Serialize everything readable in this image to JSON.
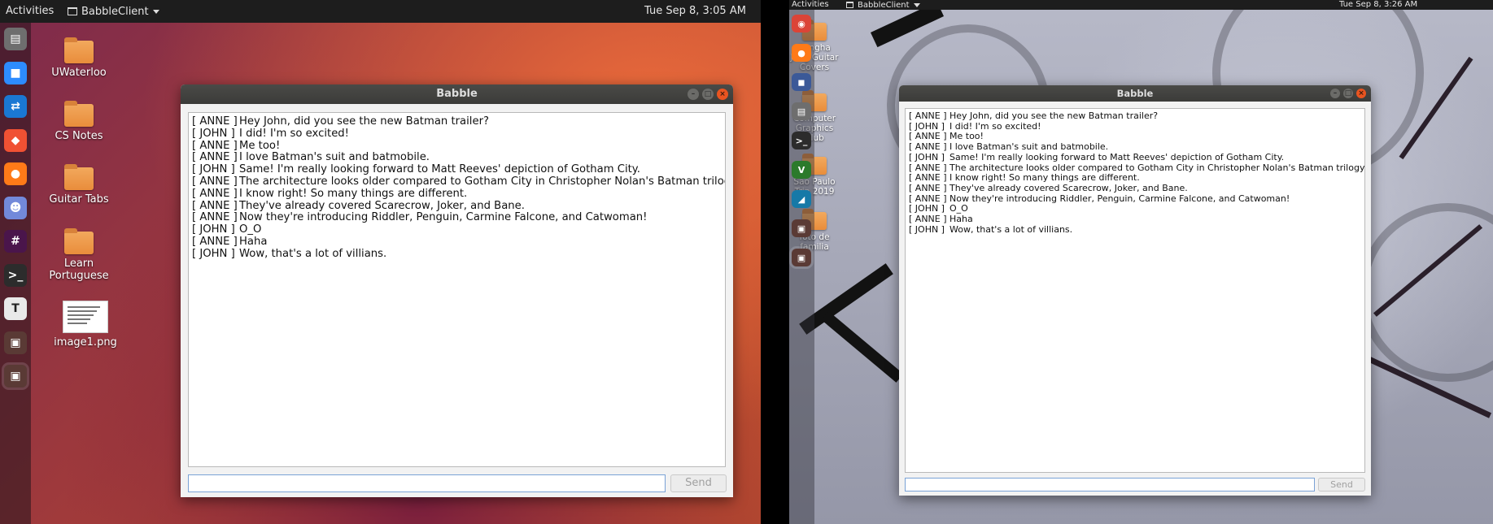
{
  "left": {
    "topbar": {
      "activities": "Activities",
      "app": "BabbleClient",
      "clock": "Tue Sep  8,  3:05 AM"
    },
    "dock": [
      {
        "icon": "files-icon",
        "glyph": "▤",
        "color": "#6e6e6e"
      },
      {
        "icon": "zoom-icon",
        "glyph": "■",
        "color": "#2d8cff"
      },
      {
        "icon": "teamviewer-icon",
        "glyph": "⇄",
        "color": "#1a78d3"
      },
      {
        "icon": "git-icon",
        "glyph": "◆",
        "color": "#f05133"
      },
      {
        "icon": "firefox-icon",
        "glyph": "●",
        "color": "#ff7a18"
      },
      {
        "icon": "discord-icon",
        "glyph": "☻",
        "color": "#7289da"
      },
      {
        "icon": "slack-icon",
        "glyph": "#",
        "color": "#4a154b"
      },
      {
        "icon": "terminal-icon",
        "glyph": ">_",
        "color": "#2c2c2c"
      },
      {
        "icon": "typora-icon",
        "glyph": "T",
        "color": "#e9e9e9"
      },
      {
        "icon": "app-window-icon",
        "glyph": "▣",
        "color": "#5a3a35"
      },
      {
        "icon": "app-window-icon",
        "glyph": "▣",
        "color": "#5a3a35"
      }
    ],
    "desktop": [
      {
        "label": "UWaterloo",
        "kind": "folder"
      },
      {
        "label": "CS Notes",
        "kind": "folder"
      },
      {
        "label": "Guitar Tabs",
        "kind": "folder"
      },
      {
        "label": "Learn Portuguese",
        "kind": "folder"
      },
      {
        "label": "image1.png",
        "kind": "image"
      }
    ],
    "window": {
      "title": "Babble",
      "messages": [
        {
          "sender": "[ ANNE ]",
          "text": "Hey John, did you see the new Batman trailer?"
        },
        {
          "sender": "[ JOHN ]",
          "text": "I did! I'm so excited!"
        },
        {
          "sender": "[ ANNE ]",
          "text": "Me too!"
        },
        {
          "sender": "[ ANNE ]",
          "text": "I love Batman's suit and batmobile."
        },
        {
          "sender": "[ JOHN ]",
          "text": "Same! I'm really looking forward to Matt Reeves' depiction of Gotham City."
        },
        {
          "sender": "[ ANNE ]",
          "text": "The architecture looks older compared to Gotham City in Christopher Nolan's Batman trilogy."
        },
        {
          "sender": "[ ANNE ]",
          "text": "I know right! So many things are different."
        },
        {
          "sender": "[ ANNE ]",
          "text": "They've already covered Scarecrow, Joker, and Bane."
        },
        {
          "sender": "[ ANNE ]",
          "text": "Now they're introducing Riddler, Penguin, Carmine Falcone, and Catwoman!"
        },
        {
          "sender": "[ JOHN ]",
          "text": "O_O"
        },
        {
          "sender": "[ ANNE ]",
          "text": "Haha"
        },
        {
          "sender": "[ JOHN ]",
          "text": "Wow, that's a lot of villians."
        }
      ],
      "input_value": "",
      "send_label": "Send"
    }
  },
  "right": {
    "topbar": {
      "activities": "Activities",
      "app": "BabbleClient",
      "clock": "Tue Sep  8,  3:26 AM"
    },
    "dock": [
      {
        "icon": "chrome-icon",
        "glyph": "◉",
        "color": "#db4437"
      },
      {
        "icon": "firefox-icon",
        "glyph": "●",
        "color": "#ff7a18"
      },
      {
        "icon": "messenger-icon",
        "glyph": "◼",
        "color": "#3b5998"
      },
      {
        "icon": "files-icon",
        "glyph": "▤",
        "color": "#6e6e6e"
      },
      {
        "icon": "terminal-icon",
        "glyph": ">_",
        "color": "#2c2c2c"
      },
      {
        "icon": "vim-icon",
        "glyph": "V",
        "color": "#2b7a2b"
      },
      {
        "icon": "wireshark-icon",
        "glyph": "◢",
        "color": "#1679a7"
      },
      {
        "icon": "app-window-icon",
        "glyph": "▣",
        "color": "#5a3a35"
      },
      {
        "icon": "app-window-icon",
        "glyph": "▣",
        "color": "#5a3a35"
      }
    ],
    "desktop": [
      {
        "label": "Sungha Jung Guitar Covers",
        "kind": "folder"
      },
      {
        "label": "Computer Graphics Club",
        "kind": "folder"
      },
      {
        "label": "São Paulo Trip 2019",
        "kind": "folder"
      },
      {
        "label": "foto de familia",
        "kind": "folder"
      }
    ],
    "window": {
      "title": "Babble",
      "messages": [
        {
          "sender": "[ ANNE ]",
          "text": "Hey John, did you see the new Batman trailer?"
        },
        {
          "sender": "[ JOHN ]",
          "text": "I did! I'm so excited!"
        },
        {
          "sender": "[ ANNE ]",
          "text": "Me too!"
        },
        {
          "sender": "[ ANNE ]",
          "text": "I love Batman's suit and batmobile."
        },
        {
          "sender": "[ JOHN ]",
          "text": "Same! I'm really looking forward to Matt Reeves' depiction of Gotham City."
        },
        {
          "sender": "[ ANNE ]",
          "text": "The architecture looks older compared to Gotham City in Christopher Nolan's Batman trilogy."
        },
        {
          "sender": "[ ANNE ]",
          "text": "I know right! So many things are different."
        },
        {
          "sender": "[ ANNE ]",
          "text": "They've already covered Scarecrow, Joker, and Bane."
        },
        {
          "sender": "[ ANNE ]",
          "text": "Now they're introducing Riddler, Penguin, Carmine Falcone, and Catwoman!"
        },
        {
          "sender": "[ JOHN ]",
          "text": "O_O"
        },
        {
          "sender": "[ ANNE ]",
          "text": "Haha"
        },
        {
          "sender": "[ JOHN ]",
          "text": "Wow, that's a lot of villians."
        }
      ],
      "input_value": "",
      "send_label": "Send"
    }
  }
}
